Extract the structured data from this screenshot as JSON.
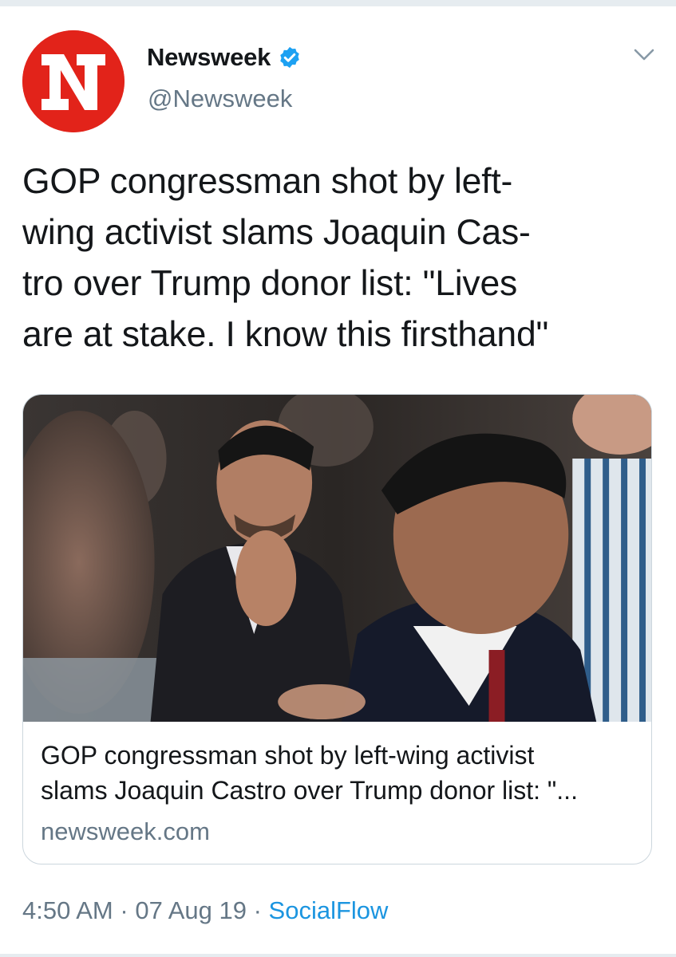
{
  "tweet": {
    "account": {
      "display_name": "Newsweek",
      "handle": "@Newsweek",
      "avatar_letter": "N",
      "verified": true
    },
    "text": "GOP congressman shot by left-\nwing activist slams Joaquin Cas-\ntro over Trump donor list: \"Lives\nare at stake. I know this firsthand\"",
    "card": {
      "title": "GOP congressman shot by left-wing activist\nslams Joaquin Castro over Trump donor list: \"...",
      "domain": "newsweek.com"
    },
    "meta": {
      "time": "4:50 AM",
      "separator": "·",
      "date": "07 Aug 19",
      "source": "SocialFlow"
    }
  },
  "colors": {
    "brand_red": "#e2231a",
    "verified_blue": "#1da1f2",
    "link_blue": "#1b95e0",
    "secondary_text": "#657786"
  },
  "icons": {
    "verified": "verified-badge-icon",
    "menu": "chevron-down-icon"
  }
}
